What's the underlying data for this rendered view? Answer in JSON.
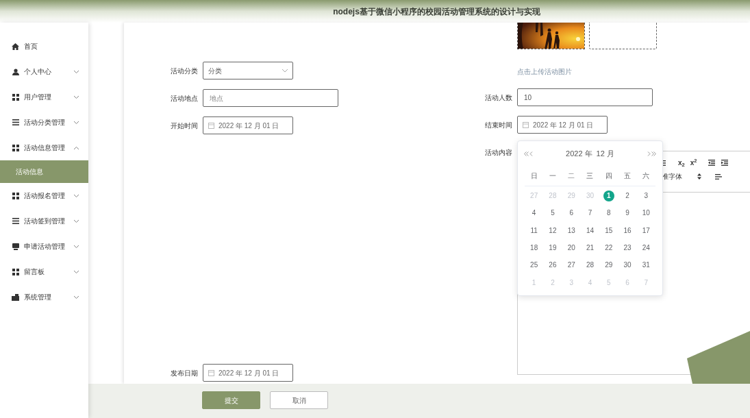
{
  "header": {
    "title": "nodejs基于微信小程序的校园活动管理系统的设计与实现"
  },
  "sidebar": {
    "items": [
      {
        "label": "首页",
        "selected": false
      },
      {
        "label": "个人中心",
        "selected": false,
        "expanded": false
      },
      {
        "label": "用户管理",
        "selected": false,
        "expanded": false
      },
      {
        "label": "活动分类管理",
        "selected": false,
        "expanded": false
      },
      {
        "label": "活动信息管理",
        "selected": false,
        "expanded": true,
        "children": [
          {
            "label": "活动信息",
            "selected": true
          }
        ]
      },
      {
        "label": "活动报名管理",
        "selected": false,
        "expanded": false
      },
      {
        "label": "活动签到管理",
        "selected": false,
        "expanded": false
      },
      {
        "label": "申请活动管理",
        "selected": false,
        "expanded": false
      },
      {
        "label": "留言板",
        "selected": false,
        "expanded": false
      },
      {
        "label": "系统管理",
        "selected": false,
        "expanded": false
      }
    ]
  },
  "form": {
    "left_fields": [
      {
        "label": "活动分类",
        "kind": "select",
        "value": "分类"
      },
      {
        "label": "活动地点",
        "kind": "text",
        "placeholder": "地点"
      },
      {
        "label": "开始时间",
        "kind": "date",
        "value": "2022 年 12 月 01 日"
      }
    ],
    "upload": {
      "images": [
        {
          "kind": "picture"
        },
        {
          "kind": "empty"
        }
      ],
      "caption": "点击上传活动图片"
    },
    "right_fields": [
      {
        "label": "活动人数",
        "kind": "text",
        "value": "10"
      },
      {
        "label": "结束时间",
        "kind": "date",
        "value": "2022 年 12 月 01 日"
      }
    ],
    "content": {
      "label": "活动内容",
      "toolbar_buttons": [
        "x$_{2}$",
        "x$^{2}$"
      ],
      "font_select": "准字体"
    },
    "publish_date": {
      "label": "发布日期",
      "kind": "date",
      "value": "2022 年 12 月 01 日"
    },
    "buttons": [
      {
        "label": "提交",
        "kind": "primary"
      },
      {
        "label": "取消",
        "kind": "default"
      }
    ]
  },
  "calendar": {
    "year": "2022 年",
    "month": "12 月",
    "weekdays": [
      "日",
      "一",
      "二",
      "三",
      "四",
      "五",
      "六"
    ],
    "days": [
      {
        "text": "27",
        "kind": "other",
        "selected": false
      },
      {
        "text": "28",
        "kind": "other",
        "selected": false
      },
      {
        "text": "29",
        "kind": "other",
        "selected": false
      },
      {
        "text": "30",
        "kind": "other",
        "selected": false
      },
      {
        "text": "1",
        "kind": "current",
        "selected": true
      },
      {
        "text": "2",
        "kind": "current",
        "selected": false
      },
      {
        "text": "3",
        "kind": "current",
        "selected": false
      },
      {
        "text": "4",
        "kind": "current",
        "selected": false
      },
      {
        "text": "5",
        "kind": "current",
        "selected": false
      },
      {
        "text": "6",
        "kind": "current",
        "selected": false
      },
      {
        "text": "7",
        "kind": "current",
        "selected": false
      },
      {
        "text": "8",
        "kind": "current",
        "selected": false
      },
      {
        "text": "9",
        "kind": "current",
        "selected": false
      },
      {
        "text": "10",
        "kind": "current",
        "selected": false
      },
      {
        "text": "11",
        "kind": "current",
        "selected": false
      },
      {
        "text": "12",
        "kind": "current",
        "selected": false
      },
      {
        "text": "13",
        "kind": "current",
        "selected": false
      },
      {
        "text": "14",
        "kind": "current",
        "selected": false
      },
      {
        "text": "15",
        "kind": "current",
        "selected": false
      },
      {
        "text": "16",
        "kind": "current",
        "selected": false
      },
      {
        "text": "17",
        "kind": "current",
        "selected": false
      },
      {
        "text": "18",
        "kind": "current",
        "selected": false
      },
      {
        "text": "19",
        "kind": "current",
        "selected": false
      },
      {
        "text": "20",
        "kind": "current",
        "selected": false
      },
      {
        "text": "21",
        "kind": "current",
        "selected": false
      },
      {
        "text": "22",
        "kind": "current",
        "selected": false
      },
      {
        "text": "23",
        "kind": "current",
        "selected": false
      },
      {
        "text": "24",
        "kind": "current",
        "selected": false
      },
      {
        "text": "25",
        "kind": "current",
        "selected": false
      },
      {
        "text": "26",
        "kind": "current",
        "selected": false
      },
      {
        "text": "27",
        "kind": "current",
        "selected": false
      },
      {
        "text": "28",
        "kind": "current",
        "selected": false
      },
      {
        "text": "29",
        "kind": "current",
        "selected": false
      },
      {
        "text": "30",
        "kind": "current",
        "selected": false
      },
      {
        "text": "31",
        "kind": "current",
        "selected": false
      },
      {
        "text": "1",
        "kind": "other",
        "selected": false
      },
      {
        "text": "2",
        "kind": "other",
        "selected": false
      },
      {
        "text": "3",
        "kind": "other",
        "selected": false
      },
      {
        "text": "4",
        "kind": "other",
        "selected": false
      },
      {
        "text": "5",
        "kind": "other",
        "selected": false
      },
      {
        "text": "6",
        "kind": "other",
        "selected": false
      },
      {
        "text": "7",
        "kind": "other",
        "selected": false
      }
    ]
  }
}
